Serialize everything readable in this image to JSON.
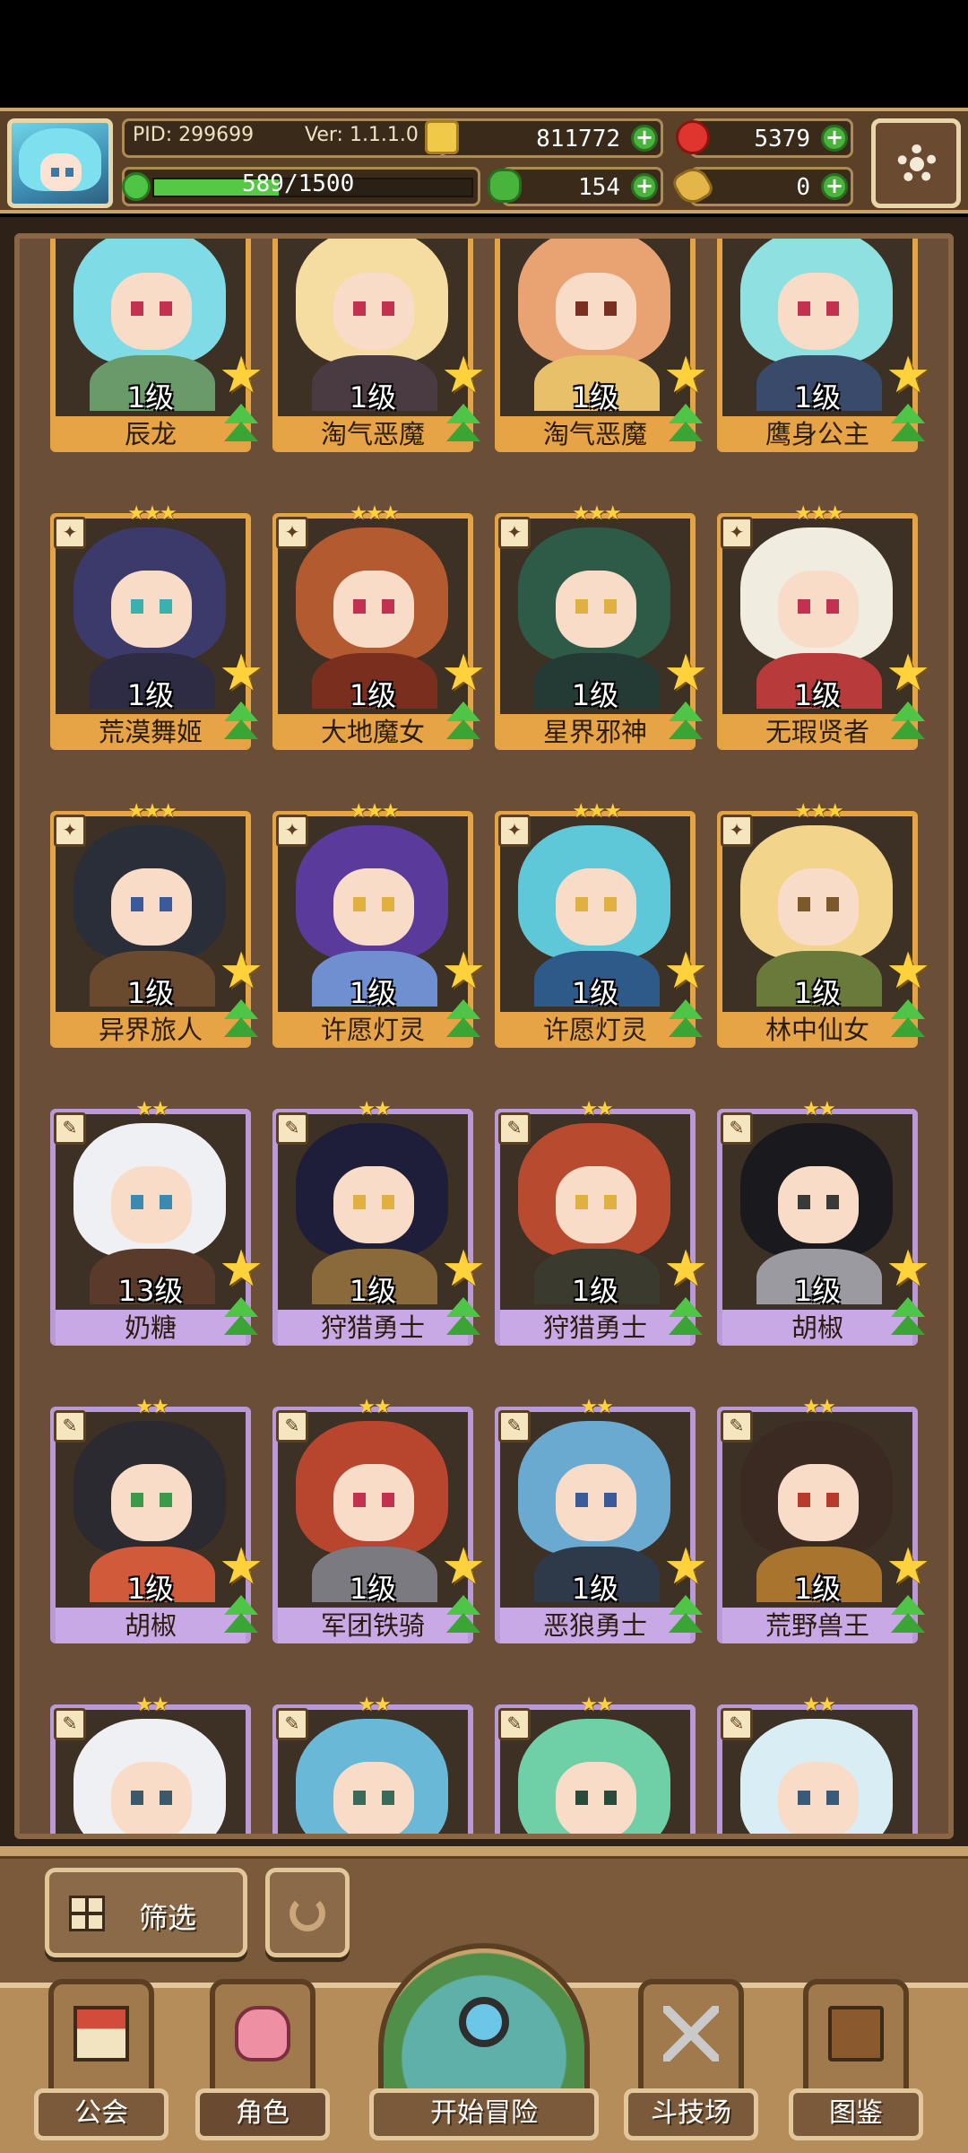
{
  "header": {
    "pid": "PID: 299699",
    "version": "Ver: 1.1.1.0",
    "exp": {
      "text": "589/1500",
      "current": 589,
      "max": 1500
    },
    "resources": {
      "coins": "811772",
      "gems": "5379",
      "clover": "154",
      "keys": "0"
    }
  },
  "cards": [
    {
      "level": "1级",
      "name": "辰龙",
      "frame": "gold",
      "rank": "",
      "hair": "#7fdce6",
      "body": "#6a9a6a",
      "eye": "#c43050"
    },
    {
      "level": "1级",
      "name": "淘气恶魔",
      "frame": "gold",
      "rank": "",
      "hair": "#f5dca0",
      "body": "#4a3a42",
      "eye": "#c43050"
    },
    {
      "level": "1级",
      "name": "淘气恶魔",
      "frame": "gold",
      "rank": "",
      "hair": "#e9a272",
      "body": "#e9c06a",
      "eye": "#7a3020"
    },
    {
      "level": "1级",
      "name": "鹰身公主",
      "frame": "gold",
      "rank": "",
      "hair": "#8fe0e0",
      "body": "#3a4a6a",
      "eye": "#c43050"
    },
    {
      "level": "1级",
      "name": "荒漠舞姬",
      "frame": "gold",
      "rank": "★★★",
      "hair": "#3c3a6a",
      "body": "#2e2c44",
      "eye": "#3bb0b0"
    },
    {
      "level": "1级",
      "name": "大地魔女",
      "frame": "gold",
      "rank": "★★★",
      "hair": "#b45a30",
      "body": "#7a2e1e",
      "eye": "#c43050"
    },
    {
      "level": "1级",
      "name": "星界邪神",
      "frame": "gold",
      "rank": "★★★",
      "hair": "#2e5a48",
      "body": "#243a34",
      "eye": "#e0b040"
    },
    {
      "level": "1级",
      "name": "无瑕贤者",
      "frame": "gold",
      "rank": "★★★",
      "hair": "#f0ece0",
      "body": "#b83a3a",
      "eye": "#c43050"
    },
    {
      "level": "1级",
      "name": "异界旅人",
      "frame": "gold",
      "rank": "★★★",
      "hair": "#2a2e38",
      "body": "#6a4a2e",
      "eye": "#3a5a9a"
    },
    {
      "level": "1级",
      "name": "许愿灯灵",
      "frame": "gold",
      "rank": "★★★",
      "hair": "#5a3a9a",
      "body": "#6f8fd0",
      "eye": "#e0b040"
    },
    {
      "level": "1级",
      "name": "许愿灯灵",
      "frame": "gold",
      "rank": "★★★",
      "hair": "#5fc8d8",
      "body": "#2e5a8a",
      "eye": "#e0b040"
    },
    {
      "level": "1级",
      "name": "林中仙女",
      "frame": "gold",
      "rank": "★★★",
      "hair": "#f2d48a",
      "body": "#6a7a3a",
      "eye": "#7a5a2a"
    },
    {
      "level": "13级",
      "name": "奶糖",
      "frame": "purple",
      "rank": "★★",
      "hair": "#eef0f4",
      "body": "#5a3a2a",
      "eye": "#3a8ab0"
    },
    {
      "level": "1级",
      "name": "狩猎勇士",
      "frame": "purple",
      "rank": "★★",
      "hair": "#1e1e3a",
      "body": "#8a6a3a",
      "eye": "#e0b040"
    },
    {
      "level": "1级",
      "name": "狩猎勇士",
      "frame": "purple",
      "rank": "★★",
      "hair": "#b84a30",
      "body": "#3a3a2e",
      "eye": "#e0b040"
    },
    {
      "level": "1级",
      "name": "胡椒",
      "frame": "purple",
      "rank": "★★",
      "hair": "#1a1a1e",
      "body": "#9a9aa0",
      "eye": "#3a3a3a"
    },
    {
      "level": "1级",
      "name": "胡椒",
      "frame": "purple",
      "rank": "★★",
      "hair": "#2a2a30",
      "body": "#d05a3a",
      "eye": "#3a9a4a"
    },
    {
      "level": "1级",
      "name": "军团铁骑",
      "frame": "purple",
      "rank": "★★",
      "hair": "#b8452e",
      "body": "#7a7a80",
      "eye": "#c43050"
    },
    {
      "level": "1级",
      "name": "恶狼勇士",
      "frame": "purple",
      "rank": "★★",
      "hair": "#6aaad0",
      "body": "#2e3a4a",
      "eye": "#3a5a9a"
    },
    {
      "level": "1级",
      "name": "荒野兽王",
      "frame": "purple",
      "rank": "★★",
      "hair": "#3a2a22",
      "body": "#a8742e",
      "eye": "#b83a2a"
    },
    {
      "level": "",
      "name": "",
      "frame": "purple",
      "rank": "★★",
      "hair": "#eef0f4",
      "body": "#8a8aa0",
      "eye": "#3a5a6a"
    },
    {
      "level": "",
      "name": "",
      "frame": "purple",
      "rank": "★★",
      "hair": "#6ab8d8",
      "body": "#3a6a8a",
      "eye": "#3a6a5a"
    },
    {
      "level": "",
      "name": "",
      "frame": "purple",
      "rank": "★★",
      "hair": "#6fd0a8",
      "body": "#3a7a6a",
      "eye": "#2a4a3a"
    },
    {
      "level": "",
      "name": "",
      "frame": "purple",
      "rank": "★★",
      "hair": "#d8eef4",
      "body": "#7a9ab0",
      "eye": "#3a5a7a"
    }
  ],
  "toolbar": {
    "filter_label": "筛选"
  },
  "nav": {
    "guild": "公会",
    "role": "角色",
    "adventure": "开始冒险",
    "arena": "斗技场",
    "codex": "图鉴"
  }
}
